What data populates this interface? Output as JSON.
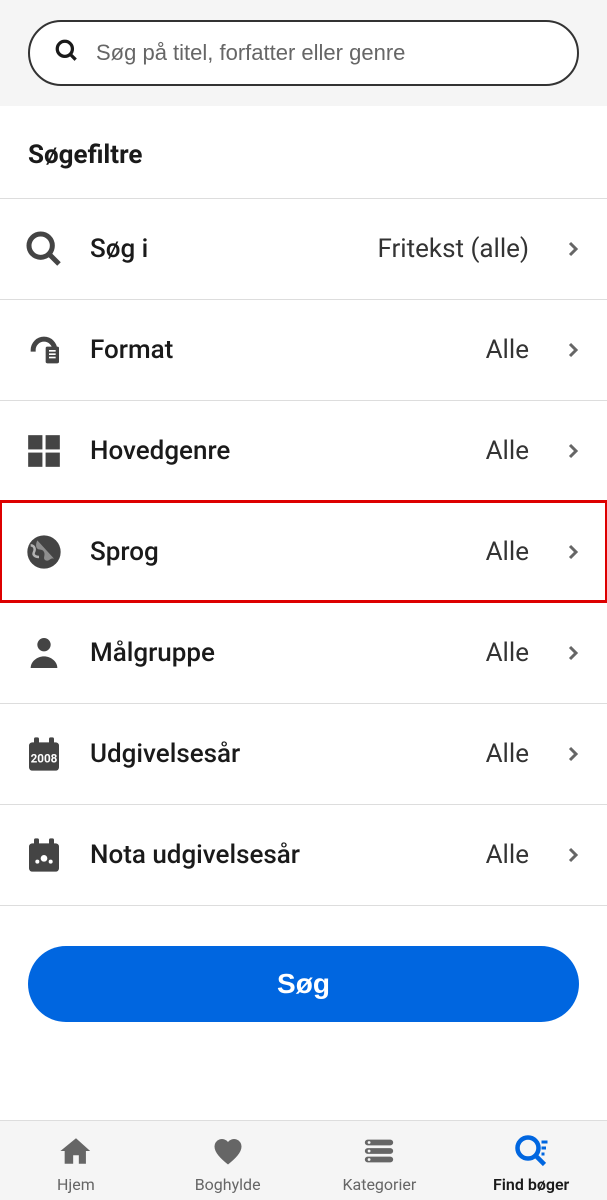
{
  "search": {
    "placeholder": "Søg på titel, forfatter eller genre"
  },
  "section_title": "Søgefiltre",
  "filters": [
    {
      "icon": "search",
      "label": "Søg i",
      "value": "Fritekst (alle)",
      "highlighted": false
    },
    {
      "icon": "format",
      "label": "Format",
      "value": "Alle",
      "highlighted": false
    },
    {
      "icon": "grid",
      "label": "Hovedgenre",
      "value": "Alle",
      "highlighted": false
    },
    {
      "icon": "globe",
      "label": "Sprog",
      "value": "Alle",
      "highlighted": true
    },
    {
      "icon": "person",
      "label": "Målgruppe",
      "value": "Alle",
      "highlighted": false
    },
    {
      "icon": "calendar-year",
      "label": "Udgivelsesår",
      "value": "Alle",
      "highlighted": false
    },
    {
      "icon": "calendar-nota",
      "label": "Nota udgivelsesår",
      "value": "Alle",
      "highlighted": false
    }
  ],
  "search_button": "Søg",
  "nav": [
    {
      "icon": "home",
      "label": "Hjem",
      "active": false
    },
    {
      "icon": "heart",
      "label": "Boghylde",
      "active": false
    },
    {
      "icon": "list",
      "label": "Kategorier",
      "active": false
    },
    {
      "icon": "search-find",
      "label": "Find bøger",
      "active": true
    }
  ]
}
